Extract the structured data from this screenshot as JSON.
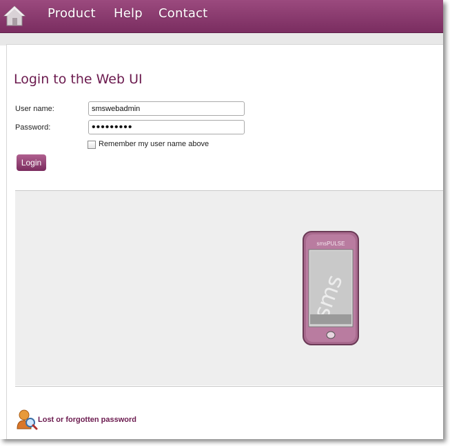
{
  "nav": {
    "home_icon": "home-icon",
    "items": [
      "Product",
      "Help",
      "Contact"
    ]
  },
  "login": {
    "title": "Login to the Web UI",
    "username_label": "User name:",
    "username_value": "smswebadmin",
    "password_label": "Password:",
    "password_value": "smswebadm",
    "remember_label": "Remember my user name above",
    "remember_checked": false,
    "button_label": "Login"
  },
  "illustration": {
    "icon": "phone-illustration",
    "phone_brand": "smsPULSE",
    "screen_text": "sms"
  },
  "footer": {
    "lost_icon": "user-search-icon",
    "lost_link": "Lost or forgotten password"
  },
  "colors": {
    "brand": "#7a2d60",
    "title": "#6b1a4e"
  }
}
